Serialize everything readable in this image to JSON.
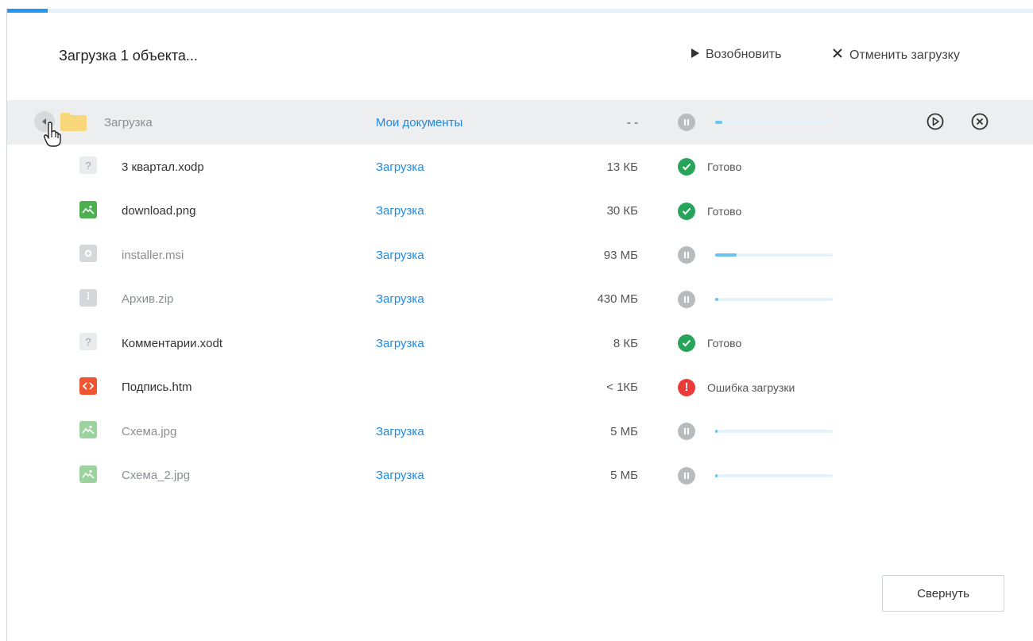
{
  "progress": {
    "top_fraction": 0.04
  },
  "header": {
    "title": "Загрузка 1 объекта...",
    "resume_label": "Возобновить",
    "cancel_label": "Отменить загрузку"
  },
  "group": {
    "name": "Загрузка",
    "destination": "Мои документы",
    "size": "- -",
    "progress": 0.06
  },
  "files": [
    {
      "name": "3 квартал.xodp",
      "type": "unknown",
      "dest": "Загрузка",
      "size": "13 КБ",
      "status": "done",
      "status_text": "Готово"
    },
    {
      "name": "download.png",
      "type": "image",
      "dest": "Загрузка",
      "size": "30 КБ",
      "status": "done",
      "status_text": "Готово"
    },
    {
      "name": "installer.msi",
      "type": "msi",
      "dest": "Загрузка",
      "size": "93 МБ",
      "status": "paused",
      "progress": 0.18
    },
    {
      "name": "Архив.zip",
      "type": "zip",
      "dest": "Загрузка",
      "size": "430 МБ",
      "status": "paused",
      "progress": 0.03
    },
    {
      "name": "Комментарии.xodt",
      "type": "unknown",
      "dest": "Загрузка",
      "size": "8 КБ",
      "status": "done",
      "status_text": "Готово"
    },
    {
      "name": "Подпись.htm",
      "type": "html",
      "dest": "",
      "size": "< 1КБ",
      "status": "error",
      "status_text": "Ошибка загрузки"
    },
    {
      "name": "Схема.jpg",
      "type": "image",
      "dest": "Загрузка",
      "size": "5 МБ",
      "status": "paused",
      "progress": 0.01
    },
    {
      "name": "Схема_2.jpg",
      "type": "image",
      "dest": "Загрузка",
      "size": "5 МБ",
      "status": "paused",
      "progress": 0.0
    }
  ],
  "footer": {
    "collapse_label": "Свернуть"
  },
  "colors": {
    "accent": "#2196f3",
    "link": "#1e88e5",
    "success": "#27a35a",
    "error": "#ea3a3a",
    "paused": "#b9bcbf"
  }
}
